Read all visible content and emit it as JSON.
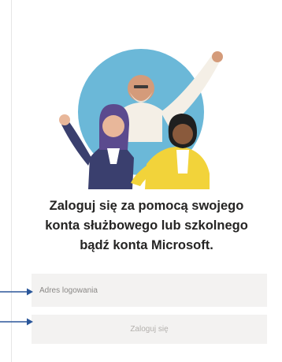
{
  "login": {
    "heading_lines": [
      "Zaloguj się za pomocą swojego",
      "konta służbowego lub szkolnego",
      "bądź konta Microsoft."
    ],
    "address_placeholder": "Adres logowania",
    "address_value": "",
    "signin_label": "Zaloguj się"
  },
  "colors": {
    "field_background": "#f3f2f1",
    "heading_text": "#252423",
    "pointer_arrow": "#2b579a",
    "illustration_circle": "#6bb8d8"
  }
}
